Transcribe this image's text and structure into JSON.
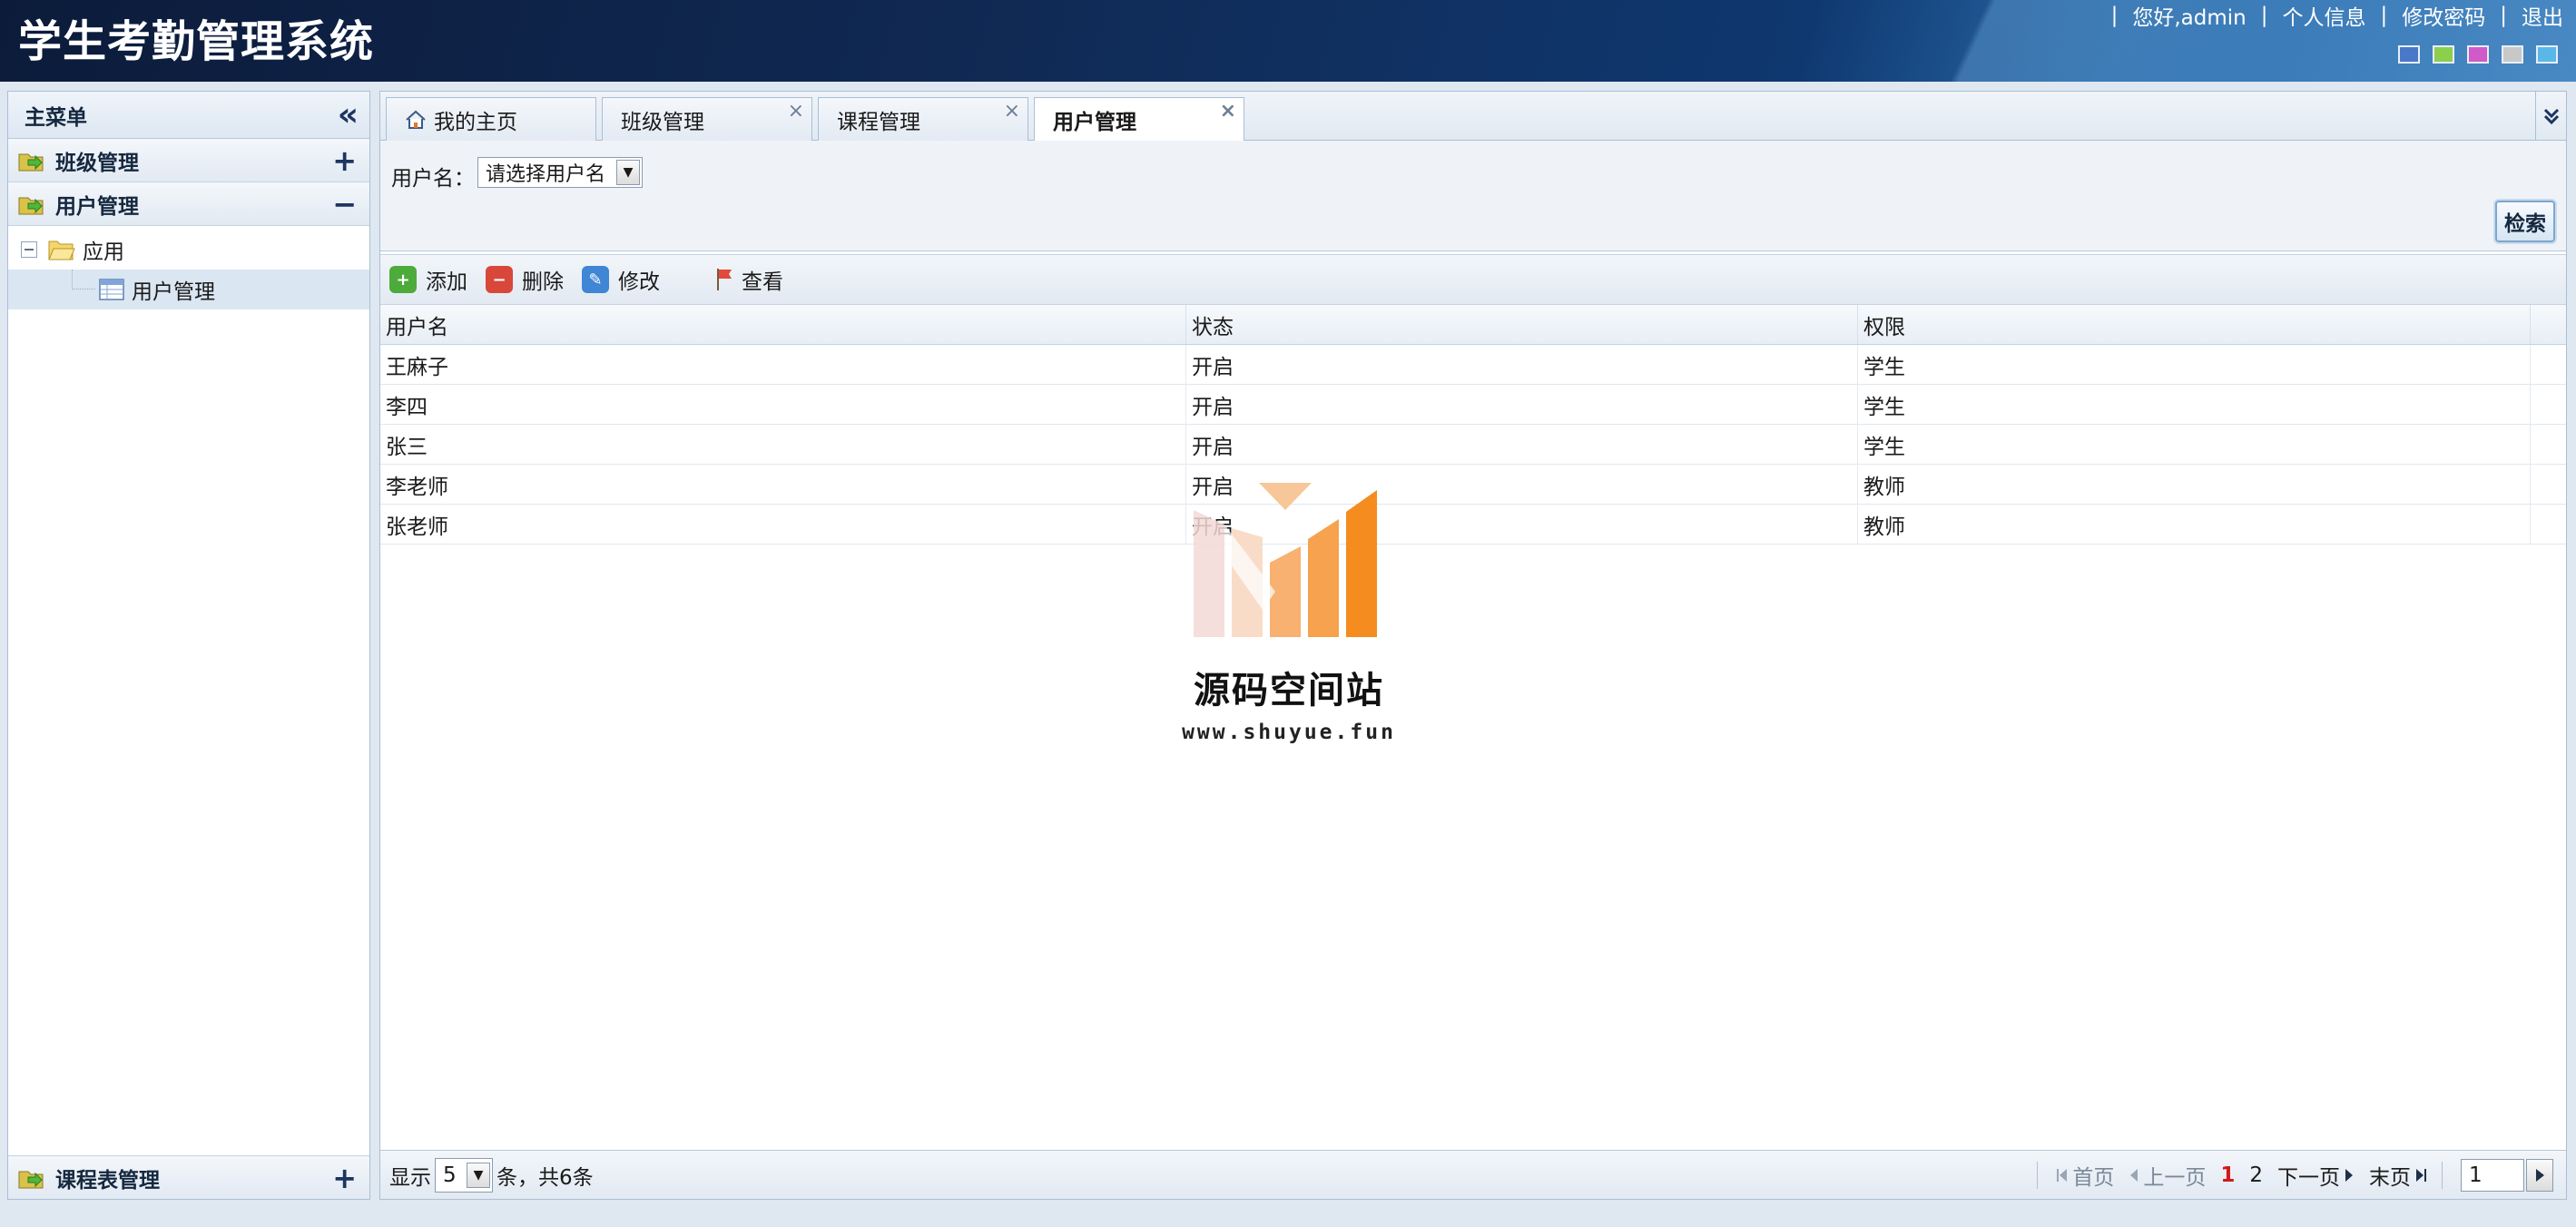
{
  "app": {
    "title": "学生考勤管理系统"
  },
  "top_links": {
    "greeting": "您好,admin",
    "profile": "个人信息",
    "change_password": "修改密码",
    "logout": "退出",
    "separator": "|"
  },
  "theme_swatches": [
    {
      "name": "theme-blue-dark",
      "color": "#4a78c8"
    },
    {
      "name": "theme-green",
      "color": "#8ccf4d"
    },
    {
      "name": "theme-pink",
      "color": "#d05ac8"
    },
    {
      "name": "theme-gray",
      "color": "#c8c8c8"
    },
    {
      "name": "theme-sky",
      "color": "#5ab8e8"
    }
  ],
  "sidebar": {
    "title": "主菜单",
    "collapse_icon": "double-chevron-left-icon",
    "sections": [
      {
        "label": "班级管理",
        "toggle": "+"
      },
      {
        "label": "用户管理",
        "toggle": "−"
      }
    ],
    "tree": {
      "folder": "应用",
      "item": "用户管理"
    },
    "bottom_section": {
      "label": "课程表管理",
      "toggle": "+"
    }
  },
  "tabs": [
    {
      "label": "我的主页",
      "icon": "home-icon"
    },
    {
      "label": "班级管理",
      "close": "×"
    },
    {
      "label": "课程管理",
      "close": "×"
    },
    {
      "label": "用户管理",
      "close": "×"
    }
  ],
  "search": {
    "label": "用户名：",
    "select_value": "请选择用户名",
    "button": "检索"
  },
  "toolbar": {
    "add": "添加",
    "delete": "删除",
    "edit": "修改",
    "view": "查看"
  },
  "table": {
    "columns": [
      "用户名",
      "状态",
      "权限"
    ],
    "rows": [
      [
        "王麻子",
        "开启",
        "学生"
      ],
      [
        "李四",
        "开启",
        "学生"
      ],
      [
        "张三",
        "开启",
        "学生"
      ],
      [
        "李老师",
        "开启",
        "教师"
      ],
      [
        "张老师",
        "开启",
        "教师"
      ]
    ]
  },
  "watermark": {
    "title": "源码空间站",
    "url": "www.shuyue.fun"
  },
  "pager": {
    "show_label": "显示",
    "page_size": "5",
    "summary": "条，共6条",
    "first": "首页",
    "prev": "上一页",
    "pages": [
      "1",
      "2"
    ],
    "current": "1",
    "next": "下一页",
    "last": "末页",
    "goto_value": "1"
  },
  "colors": {
    "header": "#0f2a55",
    "accent": "#a9bfd6",
    "current_page": "#d21a1a"
  }
}
